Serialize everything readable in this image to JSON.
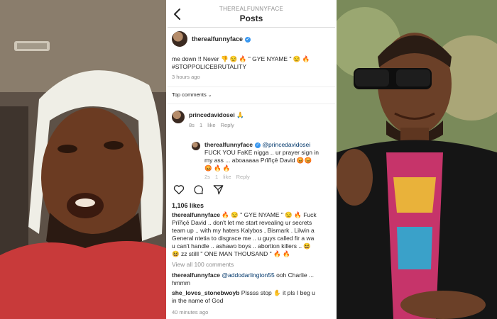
{
  "header": {
    "account": "THEREALFUNNYFACE",
    "title": "Posts"
  },
  "post": {
    "username": "therealfunnyface",
    "caption_line1": "me down !! Never 👎 😒 🔥 \" GYE NYAME \" 😒 🔥",
    "caption_line2": "#STOPPOLICEBRUTALITY",
    "time": "3 hours ago",
    "top_comments": "Top comments",
    "likes": "1,106 likes"
  },
  "comment1": {
    "user": "princedavidosei",
    "text": "🙏",
    "time": "8s",
    "likes": "1 like",
    "reply": "Reply"
  },
  "reply1": {
    "user": "therealfunnyface",
    "mention": "@princedavidosei",
    "line1": "FUCK YOU FaKE nigga .. ur prayer sign in",
    "line2": "my ass ... aboaaaaa Prĭñçē David 😡😡",
    "line3": "😡 🔥 🔥",
    "time": "2s",
    "likes": "1 like",
    "reply": "Reply"
  },
  "caption_full": {
    "user": "therealfunnyface",
    "line1": "🔥 😒 \" GYE NYAME \" 😒 🔥 Fuck",
    "line2": "Prĭñçē David .. don't let me start revealing ur secrets",
    "line3": "team up .. with my haters Kalybos , Bismark . Lilwin a",
    "line4": "General ntetia to disgrace me .. u guys called fir a wa",
    "line5": "u can't handle .. ashawo boys .. abortion killers .. 😆",
    "line6": "😆 zz stilll \" ONE MAN THOUSAND \" 🔥 🔥"
  },
  "view_all": "View all 100 comments",
  "comment2": {
    "user": "therealfunnyface",
    "mention": "@addodarlington55",
    "text": " ooh Charlie ...",
    "line2": "hmmm"
  },
  "comment3": {
    "user": "she_loves_stonebwoyb",
    "text": " Plssss stop ✋ it pls I beg u",
    "line2": "in the name of God"
  },
  "bottom_time": "40 minutes ago",
  "icons": [
    "back-arrow-icon",
    "verified-badge-icon",
    "heart-icon",
    "comment-icon",
    "share-icon",
    "chevron-down-icon"
  ],
  "colors": {
    "verified": "#3897f0",
    "meta_gray": "#8e8e8e",
    "text": "#262626"
  }
}
